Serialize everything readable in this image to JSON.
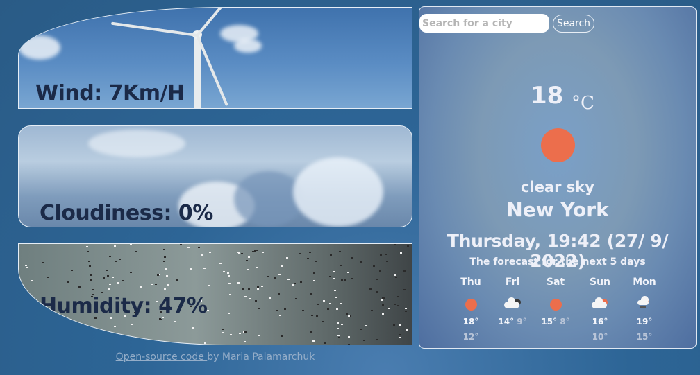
{
  "metrics": {
    "wind": {
      "label": "Wind:",
      "value": "7Km/H"
    },
    "cloudiness": {
      "label": "Cloudiness:",
      "value": "0%"
    },
    "humidity": {
      "label": "Humidity:",
      "value": "47%"
    }
  },
  "search": {
    "placeholder": "Search for a city",
    "value": "",
    "button_label": "Search"
  },
  "current": {
    "temperature": "18",
    "unit": "°C",
    "icon": "sun-icon",
    "description": "clear sky",
    "city": "New York",
    "datetime": "Thursday, 19:42 (27/ 9/ 2022)"
  },
  "forecast": {
    "title": "The forecast for the next 5 days",
    "days": [
      {
        "name": "Thu",
        "icon": "sun-icon",
        "high": "18°",
        "low": "12°"
      },
      {
        "name": "Fri",
        "icon": "cloud-dark-icon",
        "high": "14°",
        "low": "9°"
      },
      {
        "name": "Sat",
        "icon": "sun-icon",
        "high": "15°",
        "low": "8°"
      },
      {
        "name": "Sun",
        "icon": "cloud-sun-icon",
        "high": "16°",
        "low": "10°"
      },
      {
        "name": "Mon",
        "icon": "rain-sun-icon",
        "high": "19°",
        "low": "15°"
      }
    ]
  },
  "footer": {
    "link_text": "Open-source code ",
    "author_text": "by Maria Palamarchuk"
  },
  "colors": {
    "accent_sun": "#ec6e4c",
    "metric_text": "#1b2a48"
  }
}
